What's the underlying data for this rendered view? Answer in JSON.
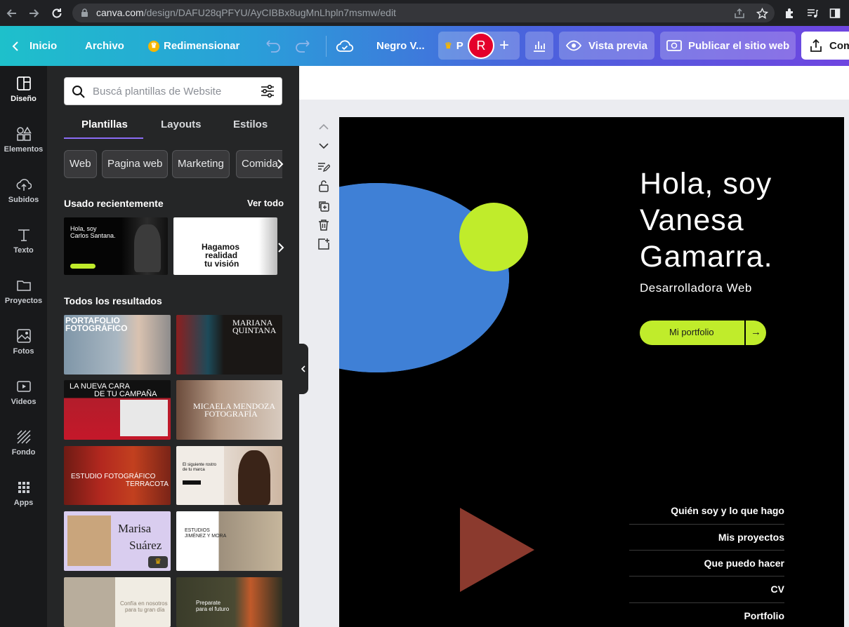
{
  "browser": {
    "url_host": "canva.com",
    "url_path": "/design/DAFU28qPFYU/AyCIBBx8ugMnLhpln7msmw/edit"
  },
  "topbar": {
    "home": "Inicio",
    "file": "Archivo",
    "resize": "Redimensionar",
    "doc_title": "Negro V...",
    "pro_label": "P",
    "avatar_letter": "R",
    "add_symbol": "+",
    "preview": "Vista previa",
    "publish": "Publicar el sitio web",
    "share": "Com",
    "gradient_colors": [
      "#1ec0cb",
      "#4a63dd",
      "#6f45e0"
    ]
  },
  "rail": {
    "items": [
      {
        "label": "Diseño",
        "icon": "layout-icon"
      },
      {
        "label": "Elementos",
        "icon": "shapes-icon"
      },
      {
        "label": "Subidos",
        "icon": "upload-cloud-icon"
      },
      {
        "label": "Texto",
        "icon": "text-icon"
      },
      {
        "label": "Proyectos",
        "icon": "folder-icon"
      },
      {
        "label": "Fotos",
        "icon": "photo-icon"
      },
      {
        "label": "Videos",
        "icon": "video-icon"
      },
      {
        "label": "Fondo",
        "icon": "pattern-icon"
      },
      {
        "label": "Apps",
        "icon": "apps-grid-icon"
      }
    ]
  },
  "panel": {
    "search_placeholder": "Buscá plantillas de Website",
    "tabs": [
      "Plantillas",
      "Layouts",
      "Estilos"
    ],
    "chips": [
      "Web",
      "Pagina web",
      "Marketing",
      "Comida"
    ],
    "recent_title": "Usado recientemente",
    "see_all": "Ver todo",
    "recent": [
      {
        "line1": "Hola, soy",
        "line2": "Carlos Santana."
      },
      {
        "line1": "Hagamos",
        "line2": "realidad",
        "line3": "tu visión"
      }
    ],
    "all_title": "Todos los resultados",
    "results": [
      {
        "text1": "PORTAFOLIO",
        "text2": "FOTOGRÁFICO"
      },
      {
        "text1": "MARIANA",
        "text2": "QUINTANA"
      },
      {
        "text1": "LA NUEVA CARA",
        "text2": "DE TU CAMPAÑA"
      },
      {
        "text1": "MICAELA MENDOZA",
        "text2": "FOTOGRAFÍA"
      },
      {
        "text1": "ESTUDIO FOTOGRÁFICO",
        "text2": "TERRACOTA"
      },
      {
        "text1": "El siguiente rostro",
        "text2": "de tu marca"
      },
      {
        "text1": "Marisa",
        "text2": "Suárez"
      },
      {
        "text1": "ESTUDIOS",
        "text2": "JIMÉNEZ Y MORA"
      },
      {
        "text1": "Confía en nosotros",
        "text2": "para tu gran día"
      },
      {
        "text1": "Preparate",
        "text2": "para el futuro"
      }
    ]
  },
  "design": {
    "greeting_line1": "Hola, soy",
    "greeting_line2": "Vanesa",
    "greeting_line3": "Gamarra.",
    "subtitle": "Desarrolladora Web",
    "cta": "Mi portfolio",
    "cta_arrow": "→",
    "nav": [
      "Quién soy y lo que hago",
      "Mis proyectos",
      "Que puedo hacer",
      "CV",
      "Portfolio"
    ],
    "colors": {
      "background": "#000000",
      "blue_circle": "#3f80d6",
      "lime": "#c0ec2b",
      "triangle": "#8b3a2e"
    }
  }
}
